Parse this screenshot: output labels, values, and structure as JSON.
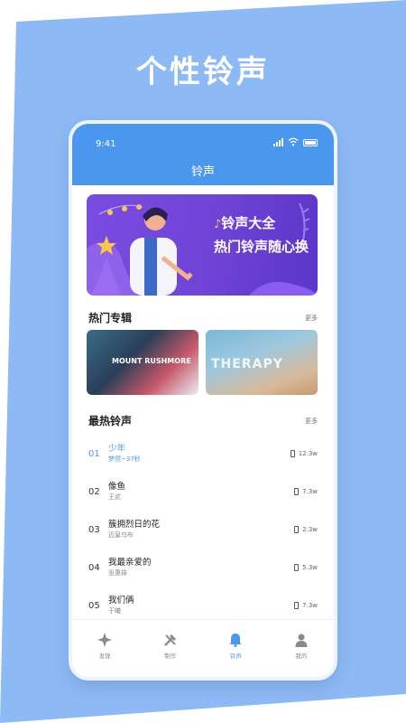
{
  "headline": "个性铃声",
  "status": {
    "time": "9:41"
  },
  "header": {
    "title": "铃声"
  },
  "banner": {
    "line1": "铃声大全",
    "line2": "热门铃声随心换"
  },
  "hot_albums": {
    "title": "热门专辑",
    "more": "更多",
    "albums": [
      {
        "cover_text": "MOUNT RUSHMORE"
      },
      {
        "cover_text": "THERAPY"
      }
    ]
  },
  "hot_songs": {
    "title": "最热铃声",
    "more": "更多",
    "items": [
      {
        "index": "01",
        "name": "少年",
        "sub": "梦然~37秒",
        "plays": "12.3w"
      },
      {
        "index": "02",
        "name": "像鱼",
        "sub": "王贰",
        "plays": "7.3w"
      },
      {
        "index": "03",
        "name": "簇拥烈日的花",
        "sub": "迈皇乌布",
        "plays": "2.3w"
      },
      {
        "index": "04",
        "name": "我最亲爱的",
        "sub": "张惠妹",
        "plays": "5.3w"
      },
      {
        "index": "05",
        "name": "我们俩",
        "sub": "于曦",
        "plays": "7.3w"
      }
    ]
  },
  "tabs": [
    {
      "label": "发现",
      "icon": "discover-icon"
    },
    {
      "label": "制作",
      "icon": "tools-icon"
    },
    {
      "label": "铃声",
      "icon": "bell-icon"
    },
    {
      "label": "我的",
      "icon": "profile-icon"
    }
  ],
  "colors": {
    "accent": "#4b97ee",
    "promo_background": "#8db9f4",
    "banner": "#7a4de0"
  }
}
